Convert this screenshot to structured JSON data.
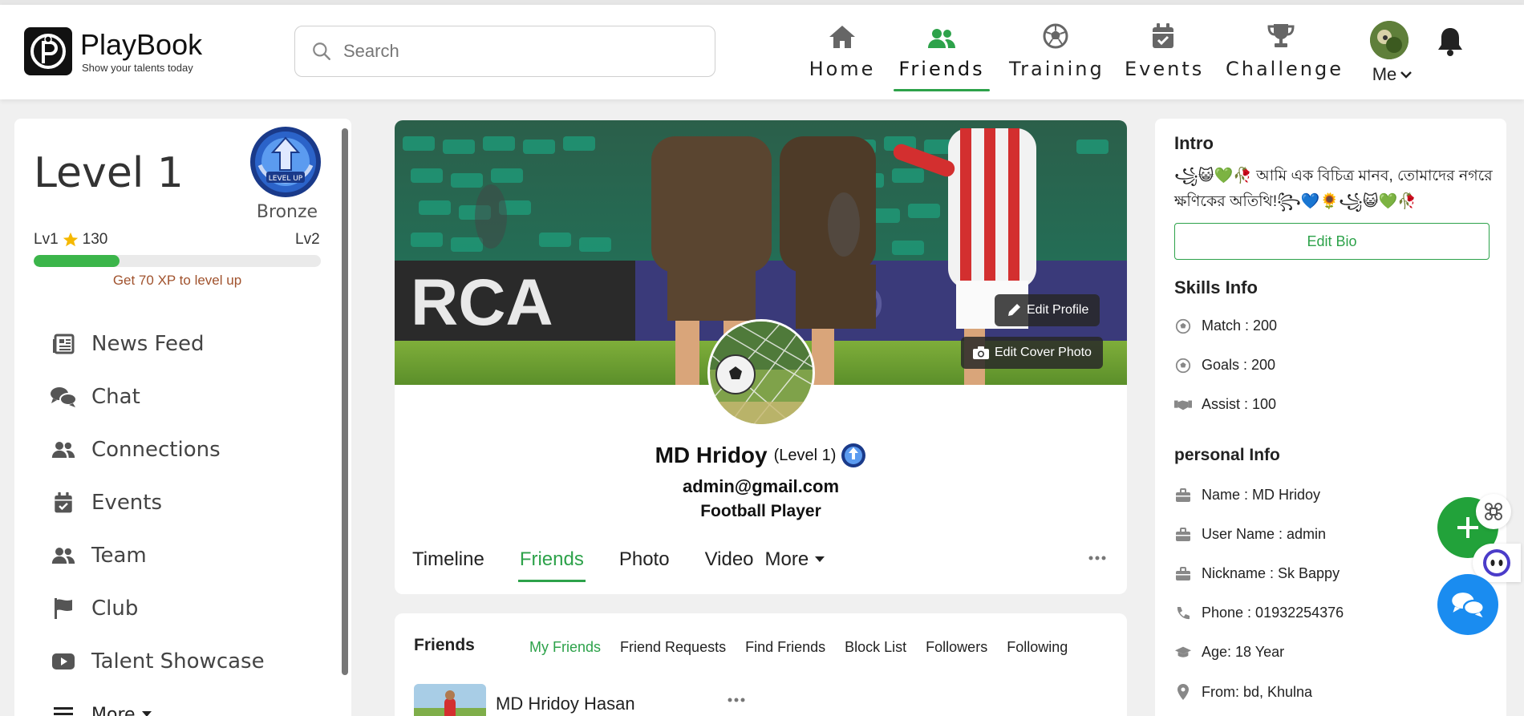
{
  "brand": {
    "name": "PlayBook",
    "tagline": "Show your talents today"
  },
  "search": {
    "placeholder": "Search"
  },
  "nav": {
    "items": [
      {
        "label": "Home",
        "icon": "home-icon"
      },
      {
        "label": "Friends",
        "icon": "users-icon",
        "active": true
      },
      {
        "label": "Training",
        "icon": "soccer-ball-icon"
      },
      {
        "label": "Events",
        "icon": "calendar-check-icon"
      },
      {
        "label": "Challenge",
        "icon": "trophy-icon"
      }
    ],
    "me_label": "Me"
  },
  "level": {
    "title": "Level 1",
    "badge_text": "LEVEL UP",
    "tier": "Bronze",
    "from_label": "Lv1",
    "xp": "130",
    "to_label": "Lv2",
    "progress_percent": 30,
    "hint": "Get 70 XP to level up"
  },
  "sidebar": {
    "items": [
      {
        "label": "News Feed",
        "icon": "newspaper-icon"
      },
      {
        "label": "Chat",
        "icon": "chat-bubbles-icon"
      },
      {
        "label": "Connections",
        "icon": "users-icon"
      },
      {
        "label": "Events",
        "icon": "calendar-check-icon"
      },
      {
        "label": "Team",
        "icon": "users-icon"
      },
      {
        "label": "Club",
        "icon": "flag-icon"
      },
      {
        "label": "Talent Showcase",
        "icon": "youtube-icon"
      },
      {
        "label": "More",
        "icon": "bars-icon"
      }
    ]
  },
  "profile": {
    "edit_profile": "Edit Profile",
    "edit_cover": "Edit Cover Photo",
    "name": "MD Hridoy",
    "level_tag": "(Level 1)",
    "email": "admin@gmail.com",
    "role": "Football Player",
    "tabs": [
      "Timeline",
      "Friends",
      "Photo",
      "Video"
    ],
    "more_tab": "More",
    "active_tab": "Friends"
  },
  "friends": {
    "title": "Friends",
    "tabs": [
      "My Friends",
      "Friend Requests",
      "Find Friends",
      "Block List",
      "Followers",
      "Following"
    ],
    "active_tab": "My Friends",
    "list": [
      {
        "name": "MD Hridoy Hasan"
      }
    ]
  },
  "intro": {
    "title": "Intro",
    "bio": "꧁😺💚🥀 আমি এক বিচিত্র মানব, তোমাদের নগরে ক্ষণিকের অতিথি!꧂💙🌻꧁😺💚🥀",
    "edit_bio": "Edit Bio"
  },
  "skills": {
    "title": "Skills Info",
    "rows": [
      {
        "text": "Match : 200",
        "icon": "soccer-ball-icon"
      },
      {
        "text": "Goals : 200",
        "icon": "soccer-ball-icon"
      },
      {
        "text": "Assist : 100",
        "icon": "handshake-icon"
      }
    ]
  },
  "personal": {
    "title": "personal Info",
    "rows": [
      {
        "text": "Name : MD Hridoy",
        "icon": "briefcase-icon"
      },
      {
        "text": "User Name : admin",
        "icon": "briefcase-icon"
      },
      {
        "text": "Nickname : Sk Bappy",
        "icon": "briefcase-icon"
      },
      {
        "text": "Phone : 01932254376",
        "icon": "phone-icon"
      },
      {
        "text": "Age: 18 Year",
        "icon": "graduation-cap-icon"
      },
      {
        "text": "From: bd, Khulna",
        "icon": "map-pin-icon"
      }
    ]
  },
  "colors": {
    "accent": "#2da24a",
    "chat_fab": "#1a8cf0",
    "add_fab": "#22a23a"
  }
}
